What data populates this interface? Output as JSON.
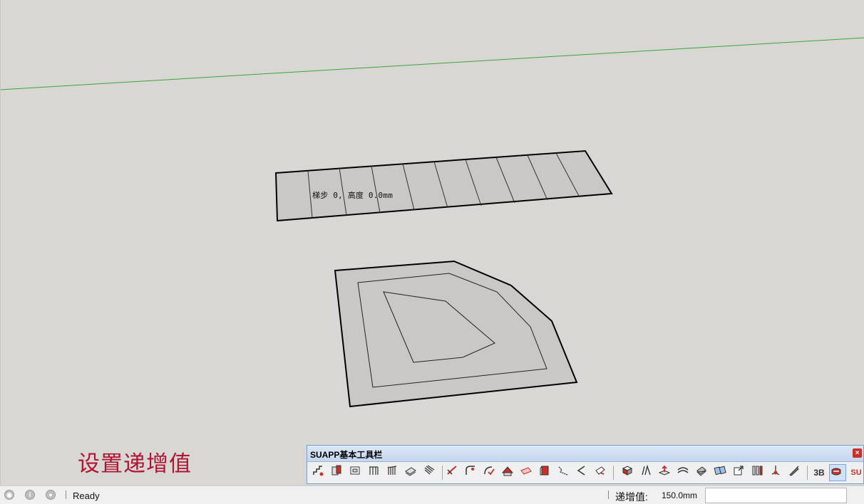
{
  "viewport": {
    "stair_label": "梯步 0, 高度 0.0mm",
    "caption": "设置递增值",
    "colors": {
      "background": "#d9d7d4",
      "axis_green": "#3aa63a",
      "face_fill": "#c9c8c6",
      "edge": "#000000",
      "caption": "#b01533"
    }
  },
  "toolbar": {
    "title": "SUAPP基本工具栏",
    "close_label": "×",
    "buttons": [
      {
        "icon": "stair-tool-icon"
      },
      {
        "icon": "wall-tool-icon"
      },
      {
        "icon": "window-frame-icon"
      },
      {
        "icon": "railing-icon"
      },
      {
        "icon": "fence-icon"
      },
      {
        "icon": "slab-icon"
      },
      {
        "icon": "louver-icon"
      },
      {
        "icon": "line-edit-icon"
      },
      {
        "icon": "arc-fillet-icon"
      },
      {
        "icon": "curve-check-icon"
      },
      {
        "icon": "roof-icon"
      },
      {
        "icon": "face-offset-icon"
      },
      {
        "icon": "extrude-icon"
      },
      {
        "icon": "path-icon"
      },
      {
        "icon": "corner-icon"
      },
      {
        "icon": "paint-face-icon"
      },
      {
        "icon": "solid-box-icon"
      },
      {
        "icon": "multi-line-icon"
      },
      {
        "icon": "push-pull-icon"
      },
      {
        "icon": "bend-icon"
      },
      {
        "icon": "shell-icon"
      },
      {
        "icon": "array-icon"
      },
      {
        "icon": "scale-box-icon"
      },
      {
        "icon": "columns-icon"
      },
      {
        "icon": "axis-tool-icon"
      },
      {
        "icon": "pen-tool-icon"
      },
      {
        "icon": "three-d-text-icon",
        "label": "3B"
      },
      {
        "icon": "active-tool-icon"
      },
      {
        "icon": "suapp-logo-icon",
        "label": "SU"
      }
    ]
  },
  "statusbar": {
    "ready": "Ready",
    "measure_label": "递增值:",
    "measure_value": "150.0mm",
    "input_value": ""
  }
}
